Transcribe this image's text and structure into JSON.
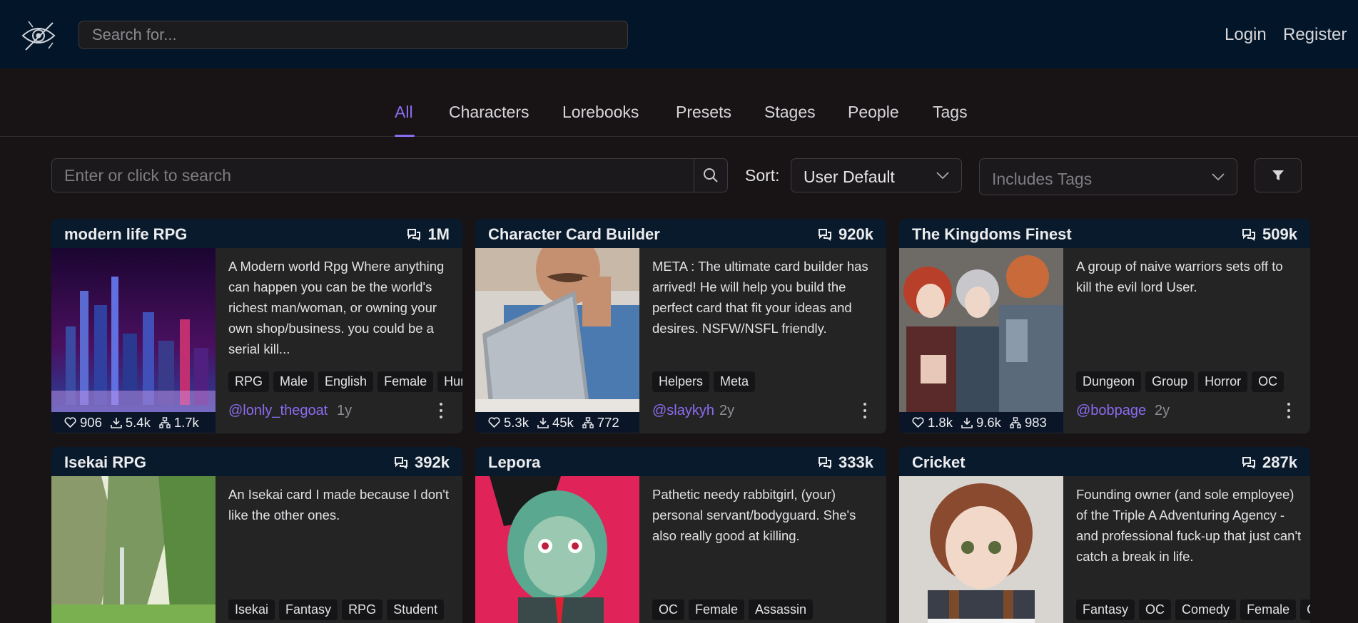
{
  "header": {
    "search_placeholder": "Search for...",
    "login": "Login",
    "register": "Register"
  },
  "tabs": [
    {
      "label": "All",
      "active": true
    },
    {
      "label": "Characters"
    },
    {
      "label": "Lorebooks"
    },
    {
      "label": "Presets"
    },
    {
      "label": "Stages"
    },
    {
      "label": "People"
    },
    {
      "label": "Tags"
    }
  ],
  "filters": {
    "search_placeholder": "Enter or click to search",
    "sort_label": "Sort:",
    "sort_value": "User Default",
    "tags_placeholder": "Includes Tags"
  },
  "colors": {
    "accent": "#8c6cf0",
    "header_bg": "#031528",
    "page_bg": "#181416",
    "card_bg": "#242425"
  },
  "cards": [
    {
      "title": "modern life RPG",
      "messages": "1M",
      "description": "A Modern world Rpg Where anything can happen you can be the world's richest man/woman, or owning your own shop/business. you could be a serial kill...",
      "tags": [
        "RPG",
        "Male",
        "English",
        "Female",
        "Human"
      ],
      "author": "@lonly_thegoat",
      "age": "1y",
      "likes": "906",
      "downloads": "5.4k",
      "forks": "1.7k",
      "image": "city-night-skyline"
    },
    {
      "title": "Character Card Builder",
      "messages": "920k",
      "description": "META : The ultimate card builder has arrived! He will help you build the perfect card that fit your ideas and desires. NSFW/NSFL friendly.",
      "tags": [
        "Helpers",
        "Meta"
      ],
      "author": "@slaykyh",
      "age": "2y",
      "likes": "5.3k",
      "downloads": "45k",
      "forks": "772",
      "image": "man-with-laptop"
    },
    {
      "title": "The Kingdoms Finest",
      "messages": "509k",
      "description": "A group of naive warriors sets off to kill the evil lord User.",
      "tags": [
        "Dungeon",
        "Group",
        "Horror",
        "OC"
      ],
      "author": "@bobpage",
      "age": "2y",
      "likes": "1.8k",
      "downloads": "9.6k",
      "forks": "983",
      "image": "anime-warriors-group"
    },
    {
      "title": "Isekai RPG",
      "messages": "392k",
      "description": "An Isekai card I made because I don't like the other ones.",
      "tags": [
        "Isekai",
        "Fantasy",
        "RPG",
        "Student"
      ],
      "image": "fantasy-cliff-landscape"
    },
    {
      "title": "Lepora",
      "messages": "333k",
      "description": "Pathetic needy rabbitgirl, (your) personal servant/bodyguard. She's also really good at killing.",
      "tags": [
        "OC",
        "Female",
        "Assassin"
      ],
      "image": "anime-rabbit-girl"
    },
    {
      "title": "Cricket",
      "messages": "287k",
      "description": "Founding owner (and sole employee) of the Triple A Adventuring Agency - and professional fuck-up that just can't catch a break in life.",
      "tags": [
        "Fantasy",
        "OC",
        "Comedy",
        "Female",
        "Cats"
      ],
      "image": "anime-adventurer-girl"
    }
  ]
}
